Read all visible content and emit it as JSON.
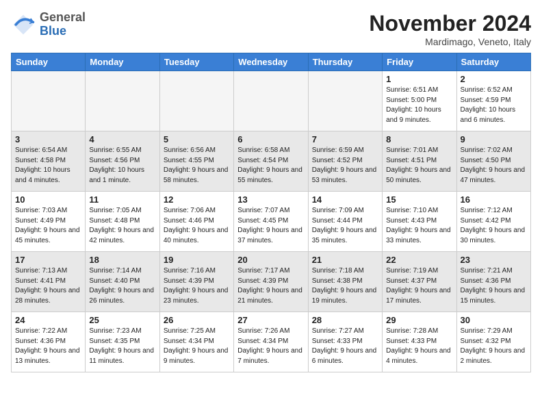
{
  "header": {
    "logo": {
      "general": "General",
      "blue": "Blue"
    },
    "title": "November 2024",
    "subtitle": "Mardimago, Veneto, Italy"
  },
  "weekdays": [
    "Sunday",
    "Monday",
    "Tuesday",
    "Wednesday",
    "Thursday",
    "Friday",
    "Saturday"
  ],
  "weeks": [
    [
      {
        "day": "",
        "info": ""
      },
      {
        "day": "",
        "info": ""
      },
      {
        "day": "",
        "info": ""
      },
      {
        "day": "",
        "info": ""
      },
      {
        "day": "",
        "info": ""
      },
      {
        "day": "1",
        "info": "Sunrise: 6:51 AM\nSunset: 5:00 PM\nDaylight: 10 hours and 9 minutes."
      },
      {
        "day": "2",
        "info": "Sunrise: 6:52 AM\nSunset: 4:59 PM\nDaylight: 10 hours and 6 minutes."
      }
    ],
    [
      {
        "day": "3",
        "info": "Sunrise: 6:54 AM\nSunset: 4:58 PM\nDaylight: 10 hours and 4 minutes."
      },
      {
        "day": "4",
        "info": "Sunrise: 6:55 AM\nSunset: 4:56 PM\nDaylight: 10 hours and 1 minute."
      },
      {
        "day": "5",
        "info": "Sunrise: 6:56 AM\nSunset: 4:55 PM\nDaylight: 9 hours and 58 minutes."
      },
      {
        "day": "6",
        "info": "Sunrise: 6:58 AM\nSunset: 4:54 PM\nDaylight: 9 hours and 55 minutes."
      },
      {
        "day": "7",
        "info": "Sunrise: 6:59 AM\nSunset: 4:52 PM\nDaylight: 9 hours and 53 minutes."
      },
      {
        "day": "8",
        "info": "Sunrise: 7:01 AM\nSunset: 4:51 PM\nDaylight: 9 hours and 50 minutes."
      },
      {
        "day": "9",
        "info": "Sunrise: 7:02 AM\nSunset: 4:50 PM\nDaylight: 9 hours and 47 minutes."
      }
    ],
    [
      {
        "day": "10",
        "info": "Sunrise: 7:03 AM\nSunset: 4:49 PM\nDaylight: 9 hours and 45 minutes."
      },
      {
        "day": "11",
        "info": "Sunrise: 7:05 AM\nSunset: 4:48 PM\nDaylight: 9 hours and 42 minutes."
      },
      {
        "day": "12",
        "info": "Sunrise: 7:06 AM\nSunset: 4:46 PM\nDaylight: 9 hours and 40 minutes."
      },
      {
        "day": "13",
        "info": "Sunrise: 7:07 AM\nSunset: 4:45 PM\nDaylight: 9 hours and 37 minutes."
      },
      {
        "day": "14",
        "info": "Sunrise: 7:09 AM\nSunset: 4:44 PM\nDaylight: 9 hours and 35 minutes."
      },
      {
        "day": "15",
        "info": "Sunrise: 7:10 AM\nSunset: 4:43 PM\nDaylight: 9 hours and 33 minutes."
      },
      {
        "day": "16",
        "info": "Sunrise: 7:12 AM\nSunset: 4:42 PM\nDaylight: 9 hours and 30 minutes."
      }
    ],
    [
      {
        "day": "17",
        "info": "Sunrise: 7:13 AM\nSunset: 4:41 PM\nDaylight: 9 hours and 28 minutes."
      },
      {
        "day": "18",
        "info": "Sunrise: 7:14 AM\nSunset: 4:40 PM\nDaylight: 9 hours and 26 minutes."
      },
      {
        "day": "19",
        "info": "Sunrise: 7:16 AM\nSunset: 4:39 PM\nDaylight: 9 hours and 23 minutes."
      },
      {
        "day": "20",
        "info": "Sunrise: 7:17 AM\nSunset: 4:39 PM\nDaylight: 9 hours and 21 minutes."
      },
      {
        "day": "21",
        "info": "Sunrise: 7:18 AM\nSunset: 4:38 PM\nDaylight: 9 hours and 19 minutes."
      },
      {
        "day": "22",
        "info": "Sunrise: 7:19 AM\nSunset: 4:37 PM\nDaylight: 9 hours and 17 minutes."
      },
      {
        "day": "23",
        "info": "Sunrise: 7:21 AM\nSunset: 4:36 PM\nDaylight: 9 hours and 15 minutes."
      }
    ],
    [
      {
        "day": "24",
        "info": "Sunrise: 7:22 AM\nSunset: 4:36 PM\nDaylight: 9 hours and 13 minutes."
      },
      {
        "day": "25",
        "info": "Sunrise: 7:23 AM\nSunset: 4:35 PM\nDaylight: 9 hours and 11 minutes."
      },
      {
        "day": "26",
        "info": "Sunrise: 7:25 AM\nSunset: 4:34 PM\nDaylight: 9 hours and 9 minutes."
      },
      {
        "day": "27",
        "info": "Sunrise: 7:26 AM\nSunset: 4:34 PM\nDaylight: 9 hours and 7 minutes."
      },
      {
        "day": "28",
        "info": "Sunrise: 7:27 AM\nSunset: 4:33 PM\nDaylight: 9 hours and 6 minutes."
      },
      {
        "day": "29",
        "info": "Sunrise: 7:28 AM\nSunset: 4:33 PM\nDaylight: 9 hours and 4 minutes."
      },
      {
        "day": "30",
        "info": "Sunrise: 7:29 AM\nSunset: 4:32 PM\nDaylight: 9 hours and 2 minutes."
      }
    ]
  ]
}
